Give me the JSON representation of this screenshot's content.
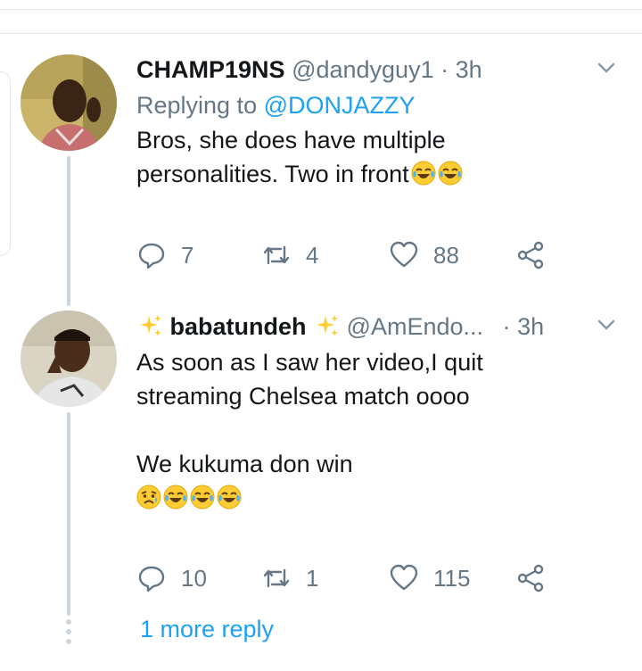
{
  "tweets": [
    {
      "display_name": "CHAMP19NS",
      "handle": "@dandyguy1",
      "separator": "·",
      "time": "3h",
      "replying_prefix": "Replying to",
      "replying_to": "@DONJAZZY",
      "text": "Bros, she does have multiple\npersonalities. Two in front",
      "emojis": [
        "face-with-tears-of-joy",
        "face-with-tears-of-joy"
      ],
      "replies": "7",
      "retweets": "4",
      "likes": "88"
    },
    {
      "name_prefix_emoji": "sparkles",
      "display_name": "babatundeh",
      "name_suffix_emoji": "sparkles",
      "handle": "@AmEndo...",
      "separator": "·",
      "time": "3h",
      "text": "As soon as I saw her video,I quit\nstreaming Chelsea match oooo\n\nWe kukuma don win",
      "emojis": [
        "sad-but-relieved-face",
        "face-with-tears-of-joy",
        "face-with-tears-of-joy",
        "face-with-tears-of-joy"
      ],
      "replies": "10",
      "retweets": "1",
      "likes": "115"
    }
  ],
  "more_replies_link": "1 more reply",
  "colors": {
    "accent": "#1da1f2",
    "muted": "#657786",
    "line": "#ccd6dd"
  }
}
